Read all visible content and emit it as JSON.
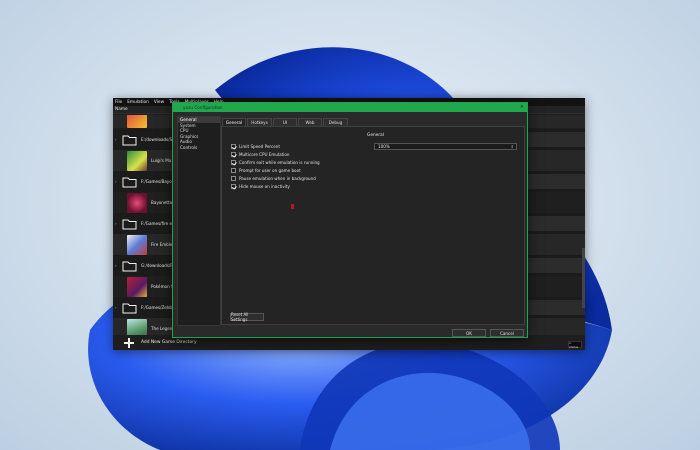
{
  "colors": {
    "accent": "#22a84c",
    "dialog_bg": "#2a2a2a",
    "window_bg": "#1e1e1e",
    "wallpaper_blue": "#1a3fd1"
  },
  "main_window": {
    "menu": [
      "File",
      "Emulation",
      "View",
      "Tools",
      "Multiplayer",
      "Help"
    ],
    "list_header": "Name",
    "rows": [
      {
        "kind": "game",
        "label": "",
        "icon": "game-thumbnail"
      },
      {
        "kind": "folder",
        "label": "E:/downloads/Sw",
        "icon": "folder-icon"
      },
      {
        "kind": "game",
        "label": "Luigi's Ma",
        "icon": "game-thumbnail"
      },
      {
        "kind": "folder",
        "label": "F:/Games/Bayone",
        "icon": "folder-icon"
      },
      {
        "kind": "game",
        "label": "Bayonetta",
        "icon": "game-thumbnail"
      },
      {
        "kind": "folder",
        "label": "F:/Games/fire em",
        "icon": "folder-icon"
      },
      {
        "kind": "game",
        "label": "Fire Emble",
        "icon": "game-thumbnail"
      },
      {
        "kind": "folder",
        "label": "G:/downloads/Po",
        "icon": "folder-icon"
      },
      {
        "kind": "game",
        "label": "Pokémon S",
        "icon": "game-thumbnail"
      },
      {
        "kind": "folder",
        "label": "F:/Games/Zelda t",
        "icon": "folder-icon"
      },
      {
        "kind": "game",
        "label": "The Legen",
        "icon": "game-thumbnail"
      }
    ],
    "add_directory": "Add New Game Directory",
    "status_badge": "x-status"
  },
  "dialog": {
    "title": "yuzu Configuration",
    "categories": [
      "General",
      "System",
      "CPU",
      "Graphics",
      "Audio",
      "Controls"
    ],
    "selected_category": "General",
    "tabs": [
      "General",
      "Hotkeys",
      "UI",
      "Web",
      "Debug"
    ],
    "active_tab": "General",
    "section_title": "General",
    "options": [
      {
        "label": "Limit Speed Percent",
        "checked": true
      },
      {
        "label": "Multicore CPU Emulation",
        "checked": true
      },
      {
        "label": "Confirm exit while emulation is running",
        "checked": true
      },
      {
        "label": "Prompt for user on game boot",
        "checked": false
      },
      {
        "label": "Pause emulation when in background",
        "checked": false
      },
      {
        "label": "Hide mouse on inactivity",
        "checked": true
      }
    ],
    "speed_value": "100%",
    "reset_label": "Reset All Settings",
    "ok_label": "OK",
    "cancel_label": "Cancel"
  }
}
